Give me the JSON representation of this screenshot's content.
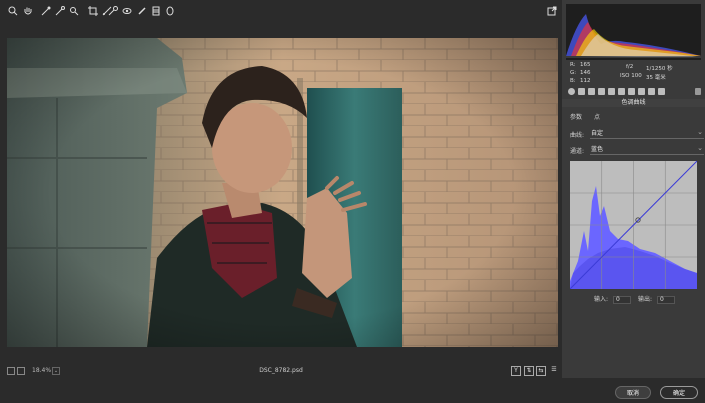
{
  "toolbar": {
    "tools": [
      "zoom-icon",
      "hand-icon",
      "white-balance-icon",
      "color-sampler-icon",
      "target-adjust-icon",
      "crop-icon",
      "straighten-icon",
      "spot-removal-icon",
      "red-eye-icon",
      "adjustment-brush-icon",
      "graduated-filter-icon",
      "radial-filter-icon"
    ]
  },
  "info": {
    "r_label": "R:",
    "r_value": "165",
    "g_label": "G:",
    "g_value": "146",
    "b_label": "B:",
    "b_value": "112",
    "aperture": "f/2",
    "shutter": "1/1250 秒",
    "iso": "ISO 100",
    "focal": "35 毫米"
  },
  "panel": {
    "title": "色调曲线",
    "tab_parametric": "参数",
    "tab_point": "点",
    "curve_label": "曲线:",
    "curve_value": "自定",
    "channel_label": "通道:",
    "channel_value": "蓝色",
    "input_label": "输入:",
    "input_value": "0",
    "output_label": "输出:",
    "output_value": "0"
  },
  "status": {
    "zoom": "18.4%",
    "filename": "DSC_8782.psd",
    "view_toggle": "Y"
  },
  "buttons": {
    "cancel": "取消",
    "ok": "确定"
  },
  "colors": {
    "accent_blue": "#5b52f0",
    "panel_bg": "#3a3a3a"
  }
}
